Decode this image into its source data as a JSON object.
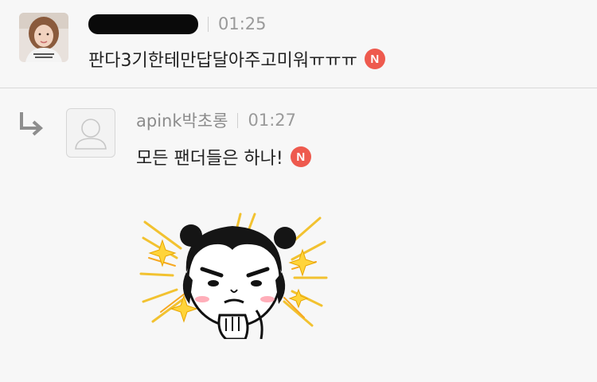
{
  "comments": [
    {
      "author_redacted": true,
      "time": "01:25",
      "text": "판다3기한테만답달아주고미워ㅠㅠㅠ",
      "badge": "N"
    },
    {
      "is_reply": true,
      "author": "apink박초롱",
      "time": "01:27",
      "text": "모든 팬더들은 하나!",
      "badge": "N",
      "has_sticker": true
    }
  ],
  "colors": {
    "background": "#f7f7f7",
    "badge": "#ee5a4e",
    "meta_text": "#9a9a9a",
    "body_text": "#222222"
  },
  "icons": [
    "reply-arrow-icon",
    "default-avatar-icon",
    "new-badge"
  ]
}
